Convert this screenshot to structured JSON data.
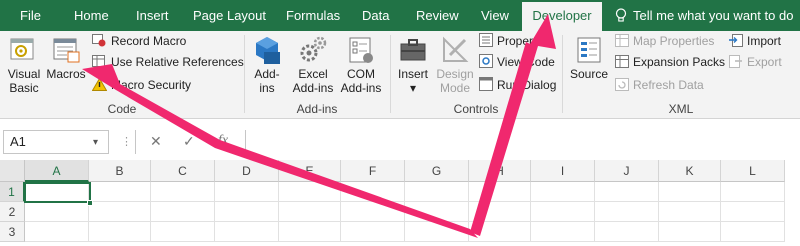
{
  "tabs": [
    "File",
    "Home",
    "Insert",
    "Page Layout",
    "Formulas",
    "Data",
    "Review",
    "View",
    "Developer"
  ],
  "tell_me": "Tell me what you want to do",
  "groups": {
    "code": {
      "label": "Code",
      "visual_basic": [
        "Visual",
        "Basic"
      ],
      "macros": "Macros",
      "record_macro": "Record Macro",
      "relative_refs": "Use Relative References",
      "macro_security": "Macro Security"
    },
    "addins": {
      "label": "Add-ins",
      "addins_btn": [
        "Add-",
        "ins"
      ],
      "excel_addins": [
        "Excel",
        "Add-ins"
      ],
      "com_addins": [
        "COM",
        "Add-ins"
      ]
    },
    "controls": {
      "label": "Controls",
      "insert": "Insert",
      "design_mode": [
        "Design",
        "Mode"
      ],
      "properties": "Properties",
      "view_code": "View Code",
      "run_dialog": "Run Dialog"
    },
    "xml": {
      "label": "XML",
      "source": "Source",
      "map_properties": "Map Properties",
      "expansion_packs": "Expansion Packs",
      "refresh_data": "Refresh Data",
      "import": "Import",
      "export": "Export"
    }
  },
  "formula_bar": {
    "name_box": "A1",
    "cancel": "✕",
    "enter": "✓",
    "fx": "fx",
    "value": ""
  },
  "sheet": {
    "columns": [
      "A",
      "B",
      "C",
      "D",
      "E",
      "F",
      "G",
      "H",
      "I",
      "J",
      "K",
      "L"
    ],
    "rows": [
      "1",
      "2",
      "3"
    ],
    "active_cell": "A1"
  },
  "colors": {
    "excel_green": "#217346",
    "annotation_arrow": "#f0286e"
  }
}
